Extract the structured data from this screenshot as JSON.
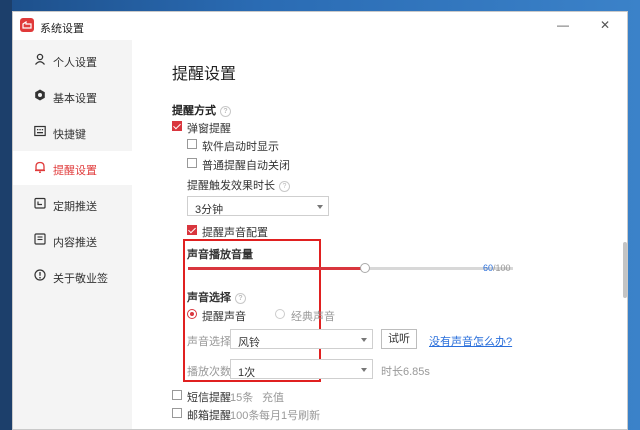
{
  "window": {
    "title": "系统设置",
    "accent": "#e03a3a"
  },
  "titlebar": {
    "minimize": "—",
    "maximize": "☐",
    "close": "✕"
  },
  "sidebar": {
    "items": [
      {
        "label": "个人设置",
        "icon": "person-icon"
      },
      {
        "label": "基本设置",
        "icon": "gear-icon"
      },
      {
        "label": "快捷键",
        "icon": "keyboard-icon"
      },
      {
        "label": "提醒设置",
        "icon": "bell-icon",
        "active": true
      },
      {
        "label": "定期推送",
        "icon": "calendar-icon"
      },
      {
        "label": "内容推送",
        "icon": "content-icon"
      },
      {
        "label": "关于敬业签",
        "icon": "info-icon"
      }
    ]
  },
  "main": {
    "page_title": "提醒设置",
    "remind_mode": {
      "title": "提醒方式",
      "help": "?",
      "popup": {
        "label": "弹窗提醒",
        "checked": true
      },
      "show_on_start": {
        "label": "软件启动时显示",
        "checked": false
      },
      "auto_close": {
        "label": "普通提醒自动关闭",
        "checked": false
      },
      "duration_label": "提醒触发效果时长",
      "duration_value": "3分钟",
      "sound_config": {
        "label": "提醒声音配置",
        "checked": true
      }
    },
    "volume": {
      "title": "声音播放音量",
      "value": 60,
      "max_text": "/100",
      "value_text": "60"
    },
    "sound_select": {
      "title": "声音选择",
      "help": "?",
      "options": [
        {
          "label": "提醒声音",
          "selected": true
        },
        {
          "label": "经典声音",
          "selected": false
        }
      ],
      "select_label": "声音选择",
      "select_value": "风铃",
      "try_button": "试听",
      "no_sound_link": "没有声音怎么办?",
      "play_count_label": "播放次数",
      "play_count_value": "1次",
      "duration_text": "时长6.85s"
    },
    "sms": {
      "label": "短信提醒",
      "count": "15条",
      "action": "充值",
      "checked": false
    },
    "mail": {
      "label": "邮箱提醒",
      "count": "100条",
      "note": "每月1号刷新",
      "checked": false
    }
  }
}
